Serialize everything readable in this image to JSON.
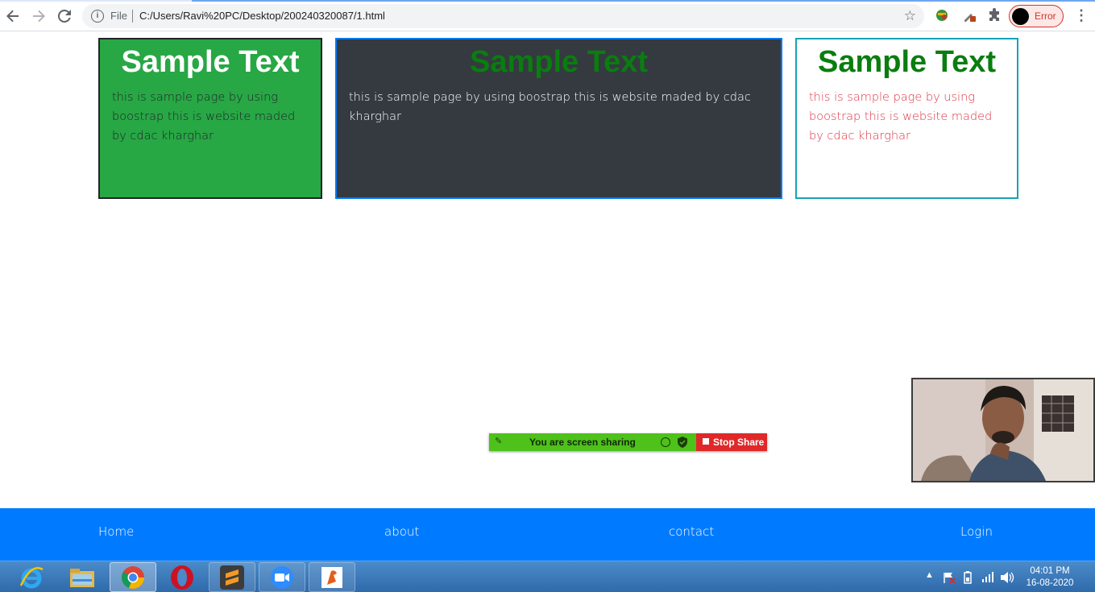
{
  "browser": {
    "omnibox": {
      "scheme_label": "File",
      "url": "C:/Users/Ravi%20PC/Desktop/200240320087/1.html"
    },
    "profile": {
      "label": "Error"
    }
  },
  "cards": [
    {
      "title": "Sample Text",
      "body": "this is sample page by using boostrap this is website maded by cdac kharghar"
    },
    {
      "title": "Sample Text",
      "body": "this is sample page by using boostrap this is website maded by cdac kharghar"
    },
    {
      "title": "Sample Text",
      "body": "this is sample page by using boostrap this is website maded by cdac kharghar"
    }
  ],
  "share_bar": {
    "message": "You are screen sharing",
    "stop_label": "Stop Share"
  },
  "footer_nav": {
    "home": "Home",
    "about": "about",
    "contact": "contact",
    "login": "Login"
  },
  "taskbar": {
    "apps": [
      "internet-explorer-icon",
      "file-explorer-icon",
      "chrome-icon",
      "opera-icon",
      "sublime-text-icon",
      "zoom-icon",
      "foxit-reader-icon"
    ],
    "clock": {
      "time": "04:01 PM",
      "date": "16-08-2020"
    }
  },
  "colors": {
    "card1_bg": "#28a745",
    "card2_bg": "#343a40",
    "card2_border": "#007bff",
    "card3_border": "#17a2b8",
    "title_green": "#0a7d0f",
    "card3_text": "#dc3545",
    "footer_bg": "#007bff"
  }
}
